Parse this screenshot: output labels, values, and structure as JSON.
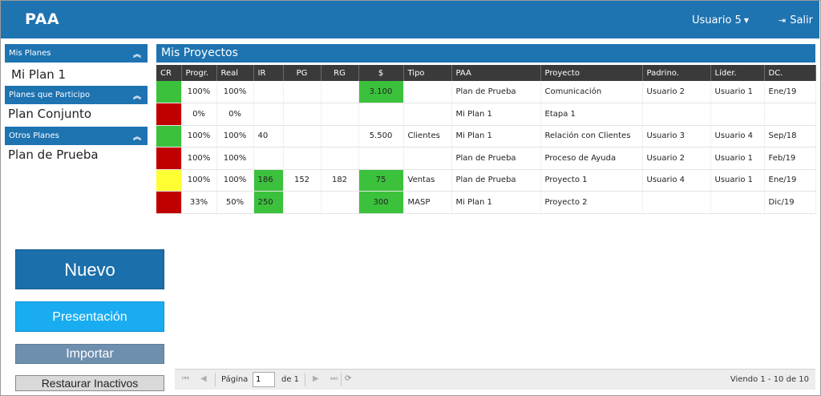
{
  "header": {
    "brand": "PAA",
    "user": "Usuario 5",
    "logout": "Salir"
  },
  "sidebar": {
    "sections": [
      {
        "title": "Mis Planes",
        "items": [
          "Mi Plan 1"
        ]
      },
      {
        "title": "Planes que Participo",
        "items": [
          "Plan Conjunto"
        ]
      },
      {
        "title": "Otros Planes",
        "items": [
          "Plan de Prueba"
        ]
      }
    ]
  },
  "buttons": {
    "nuevo": "Nuevo",
    "presentacion": "Presentación",
    "importar": "Importar",
    "restaurar": "Restaurar Inactivos"
  },
  "main": {
    "title": "Mis Proyectos",
    "columns": [
      "CR",
      "Progr.",
      "Real",
      "IR",
      "PG",
      "RG",
      "$",
      "Tipo",
      "PAA",
      "Proyecto",
      "Padrino.",
      "Líder.",
      "DC."
    ],
    "rows": [
      {
        "cr": "green",
        "progr": "100%",
        "real": "100%",
        "ir": "",
        "pg": "",
        "rg": "",
        "money": "3.100",
        "tipo": "",
        "paa": "Plan de Prueba",
        "proyecto": "Comunicación",
        "padrino": "Usuario 2",
        "lider": "Usuario 1",
        "dc": "Ene/19"
      },
      {
        "cr": "red",
        "progr": "0%",
        "real": "0%",
        "ir": "",
        "pg": "",
        "rg": "",
        "money": "",
        "tipo": "",
        "paa": "Mi Plan 1",
        "proyecto": "Etapa 1",
        "padrino": "",
        "lider": "",
        "dc": ""
      },
      {
        "cr": "green",
        "progr": "100%",
        "real": "100%",
        "ir": "40",
        "pg": "",
        "rg": "",
        "money": "5.500",
        "tipo": "Clientes",
        "paa": "Mi Plan 1",
        "proyecto": "Relación con Clientes",
        "padrino": "Usuario 3",
        "lider": "Usuario 4",
        "dc": "Sep/18"
      },
      {
        "cr": "red",
        "progr": "100%",
        "real": "100%",
        "ir": "",
        "pg": "",
        "rg": "",
        "money": "",
        "tipo": "",
        "paa": "Plan de Prueba",
        "proyecto": "Proceso de Ayuda",
        "padrino": "Usuario 2",
        "lider": "Usuario 1",
        "dc": "Feb/19"
      },
      {
        "cr": "yellow",
        "progr": "100%",
        "real": "100%",
        "ir": "186",
        "pg": "152",
        "rg": "182",
        "money": "75",
        "tipo": "Ventas",
        "paa": "Plan de Prueba",
        "proyecto": "Proyecto 1",
        "padrino": "Usuario 4",
        "lider": "Usuario 1",
        "dc": "Ene/19"
      },
      {
        "cr": "red",
        "progr": "33%",
        "real": "50%",
        "ir": "250",
        "pg": "",
        "rg": "",
        "money": "300",
        "tipo": "MASP",
        "paa": "Mi Plan 1",
        "proyecto": "Proyecto 2",
        "padrino": "",
        "lider": "",
        "dc": "Dic/19"
      }
    ],
    "highlight_ir": [
      false,
      false,
      false,
      false,
      true,
      true
    ],
    "highlight_money": [
      true,
      false,
      false,
      false,
      true,
      true
    ]
  },
  "pager": {
    "page_label": "Página",
    "page_value": "1",
    "of_label": "de 1",
    "info": "Viendo 1 - 10 de 10"
  },
  "colors": {
    "brand_blue": "#1e73b1",
    "status_green": "#3cc13c",
    "status_red": "#c00000",
    "status_yellow": "#ffff33"
  }
}
